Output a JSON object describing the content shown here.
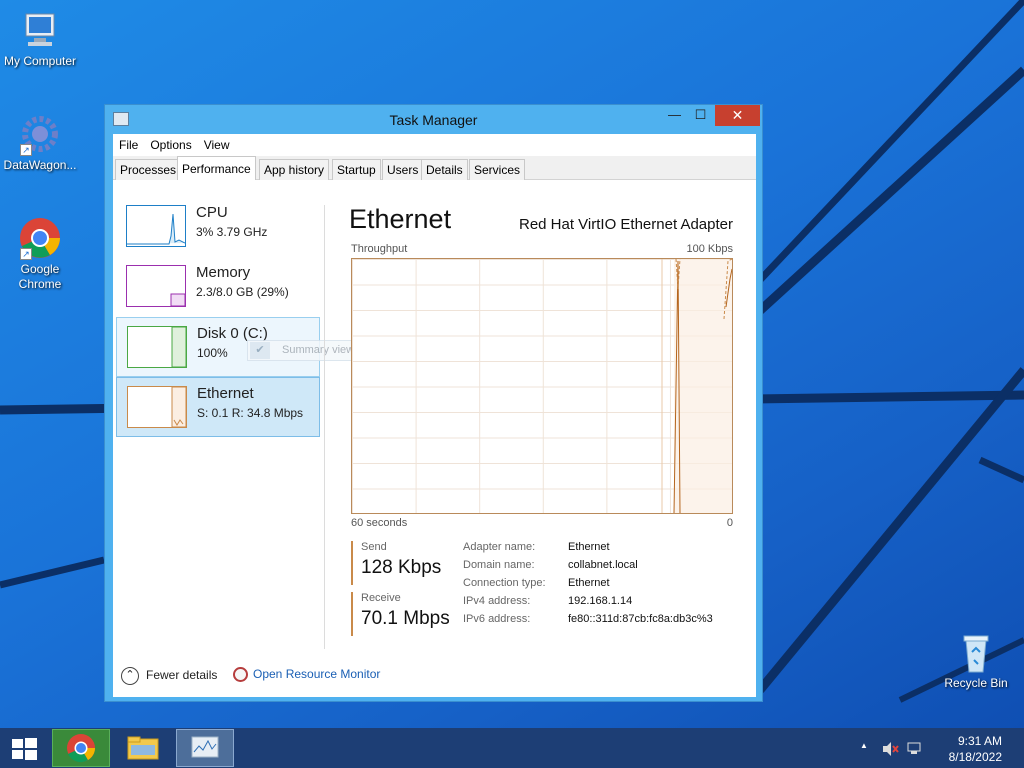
{
  "desktop": {
    "icons": [
      {
        "label": "My Computer"
      },
      {
        "label": "DataWagon..."
      },
      {
        "label": "Google Chrome"
      },
      {
        "label": "Recycle Bin"
      }
    ]
  },
  "window": {
    "title": "Task Manager",
    "controls": {
      "minimize": "—",
      "maximize": "☐",
      "close": "✕"
    },
    "menu": [
      "File",
      "Options",
      "View"
    ],
    "tabs": [
      "Processes",
      "Performance",
      "App history",
      "Startup",
      "Users",
      "Details",
      "Services"
    ],
    "active_tab": "Performance"
  },
  "resources": [
    {
      "name": "CPU",
      "value": "3% 3.79 GHz",
      "color": "#1e7fc7"
    },
    {
      "name": "Memory",
      "value": "2.3/8.0 GB (29%)",
      "color": "#9b2fae"
    },
    {
      "name": "Disk 0 (C:)",
      "value": "100%",
      "color": "#4aa844"
    },
    {
      "name": "Ethernet",
      "value": "S: 0.1  R: 34.8 Mbps",
      "color": "#c98a4a"
    }
  ],
  "context_menu": {
    "item": "Summary view",
    "check": "✔"
  },
  "detail": {
    "title": "Ethernet",
    "adapter": "Red Hat VirtIO Ethernet Adapter",
    "graph_label": "Throughput",
    "graph_max": "100 Kbps",
    "time_label": "60 seconds",
    "time_end": "0",
    "send_label": "Send",
    "send_value": "128 Kbps",
    "receive_label": "Receive",
    "receive_value": "70.1 Mbps",
    "properties": [
      {
        "key": "Adapter name:",
        "value": "Ethernet"
      },
      {
        "key": "Domain name:",
        "value": "collabnet.local"
      },
      {
        "key": "Connection type:",
        "value": "Ethernet"
      },
      {
        "key": "IPv4 address:",
        "value": "192.168.1.14"
      },
      {
        "key": "IPv6 address:",
        "value": "fe80::311d:87cb:fc8a:db3c%3"
      }
    ]
  },
  "footer": {
    "fewer_details": "Fewer details",
    "fewer_icon": "⌃",
    "open_resource_monitor": "Open Resource Monitor"
  },
  "taskbar": {
    "time": "9:31 AM",
    "date": "8/18/2022",
    "tray_arrow": "▲"
  }
}
